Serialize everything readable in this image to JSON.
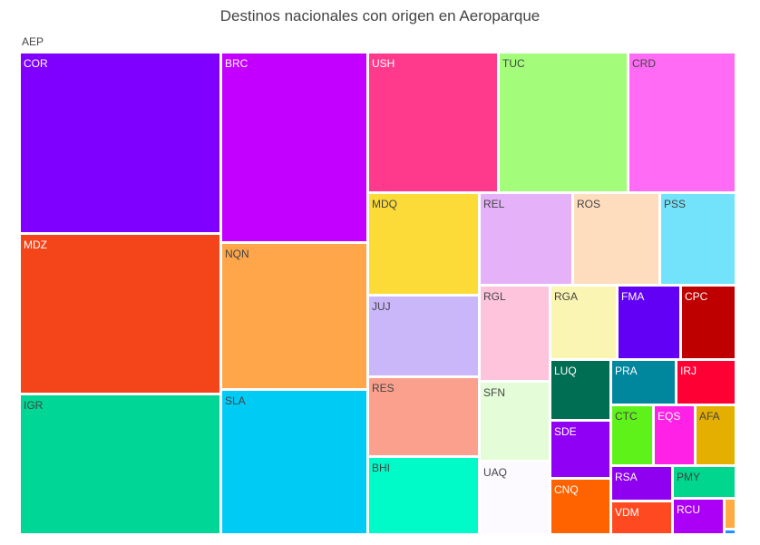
{
  "chart_data": {
    "type": "treemap",
    "title": "Destinos nacionales con origen en Aeroparque",
    "root": "AEP",
    "nodes": [
      {
        "label": "COR",
        "color": "#7F00FF"
      },
      {
        "label": "MDZ",
        "color": "#F4441A"
      },
      {
        "label": "IGR",
        "color": "#00D796"
      },
      {
        "label": "BRC",
        "color": "#C300FF"
      },
      {
        "label": "NQN",
        "color": "#FFA54A"
      },
      {
        "label": "SLA",
        "color": "#00CBF5"
      },
      {
        "label": "USH",
        "color": "#FF3A8C"
      },
      {
        "label": "TUC",
        "color": "#A3FD7B"
      },
      {
        "label": "CRD",
        "color": "#FF6BF5"
      },
      {
        "label": "MDQ",
        "color": "#FCDB39"
      },
      {
        "label": "JUJ",
        "color": "#CAB7FA"
      },
      {
        "label": "RES",
        "color": "#FCA08E"
      },
      {
        "label": "BHI",
        "color": "#00FBC9"
      },
      {
        "label": "REL",
        "color": "#E5B2FA"
      },
      {
        "label": "ROS",
        "color": "#FEDDBE"
      },
      {
        "label": "PSS",
        "color": "#72E3FA"
      },
      {
        "label": "RGL",
        "color": "#FEC4DB"
      },
      {
        "label": "RGA",
        "color": "#FAF5B3"
      },
      {
        "label": "FMA",
        "color": "#6100F5"
      },
      {
        "label": "CPC",
        "color": "#BE0000"
      },
      {
        "label": "SFN",
        "color": "#E4FDD8"
      },
      {
        "label": "LUQ",
        "color": "#006E52"
      },
      {
        "label": "PRA",
        "color": "#00879D"
      },
      {
        "label": "IRJ",
        "color": "#FF0034"
      },
      {
        "label": "UAQ",
        "color": "#FDFAFF"
      },
      {
        "label": "SDE",
        "color": "#9000F5"
      },
      {
        "label": "CTC",
        "color": "#5FF21A"
      },
      {
        "label": "EQS",
        "color": "#FF21E5"
      },
      {
        "label": "AFA",
        "color": "#E5AF00"
      },
      {
        "label": "CNQ",
        "color": "#FF6300"
      },
      {
        "label": "RSA",
        "color": "#8F00F0"
      },
      {
        "label": "PMY",
        "color": "#00D68E"
      },
      {
        "label": "VDM",
        "color": "#FF4A21"
      },
      {
        "label": "RCU",
        "color": "#AB00F5"
      },
      {
        "label": "",
        "color": "#FFAA42"
      },
      {
        "label": "",
        "color": "#1F90FF"
      }
    ]
  }
}
